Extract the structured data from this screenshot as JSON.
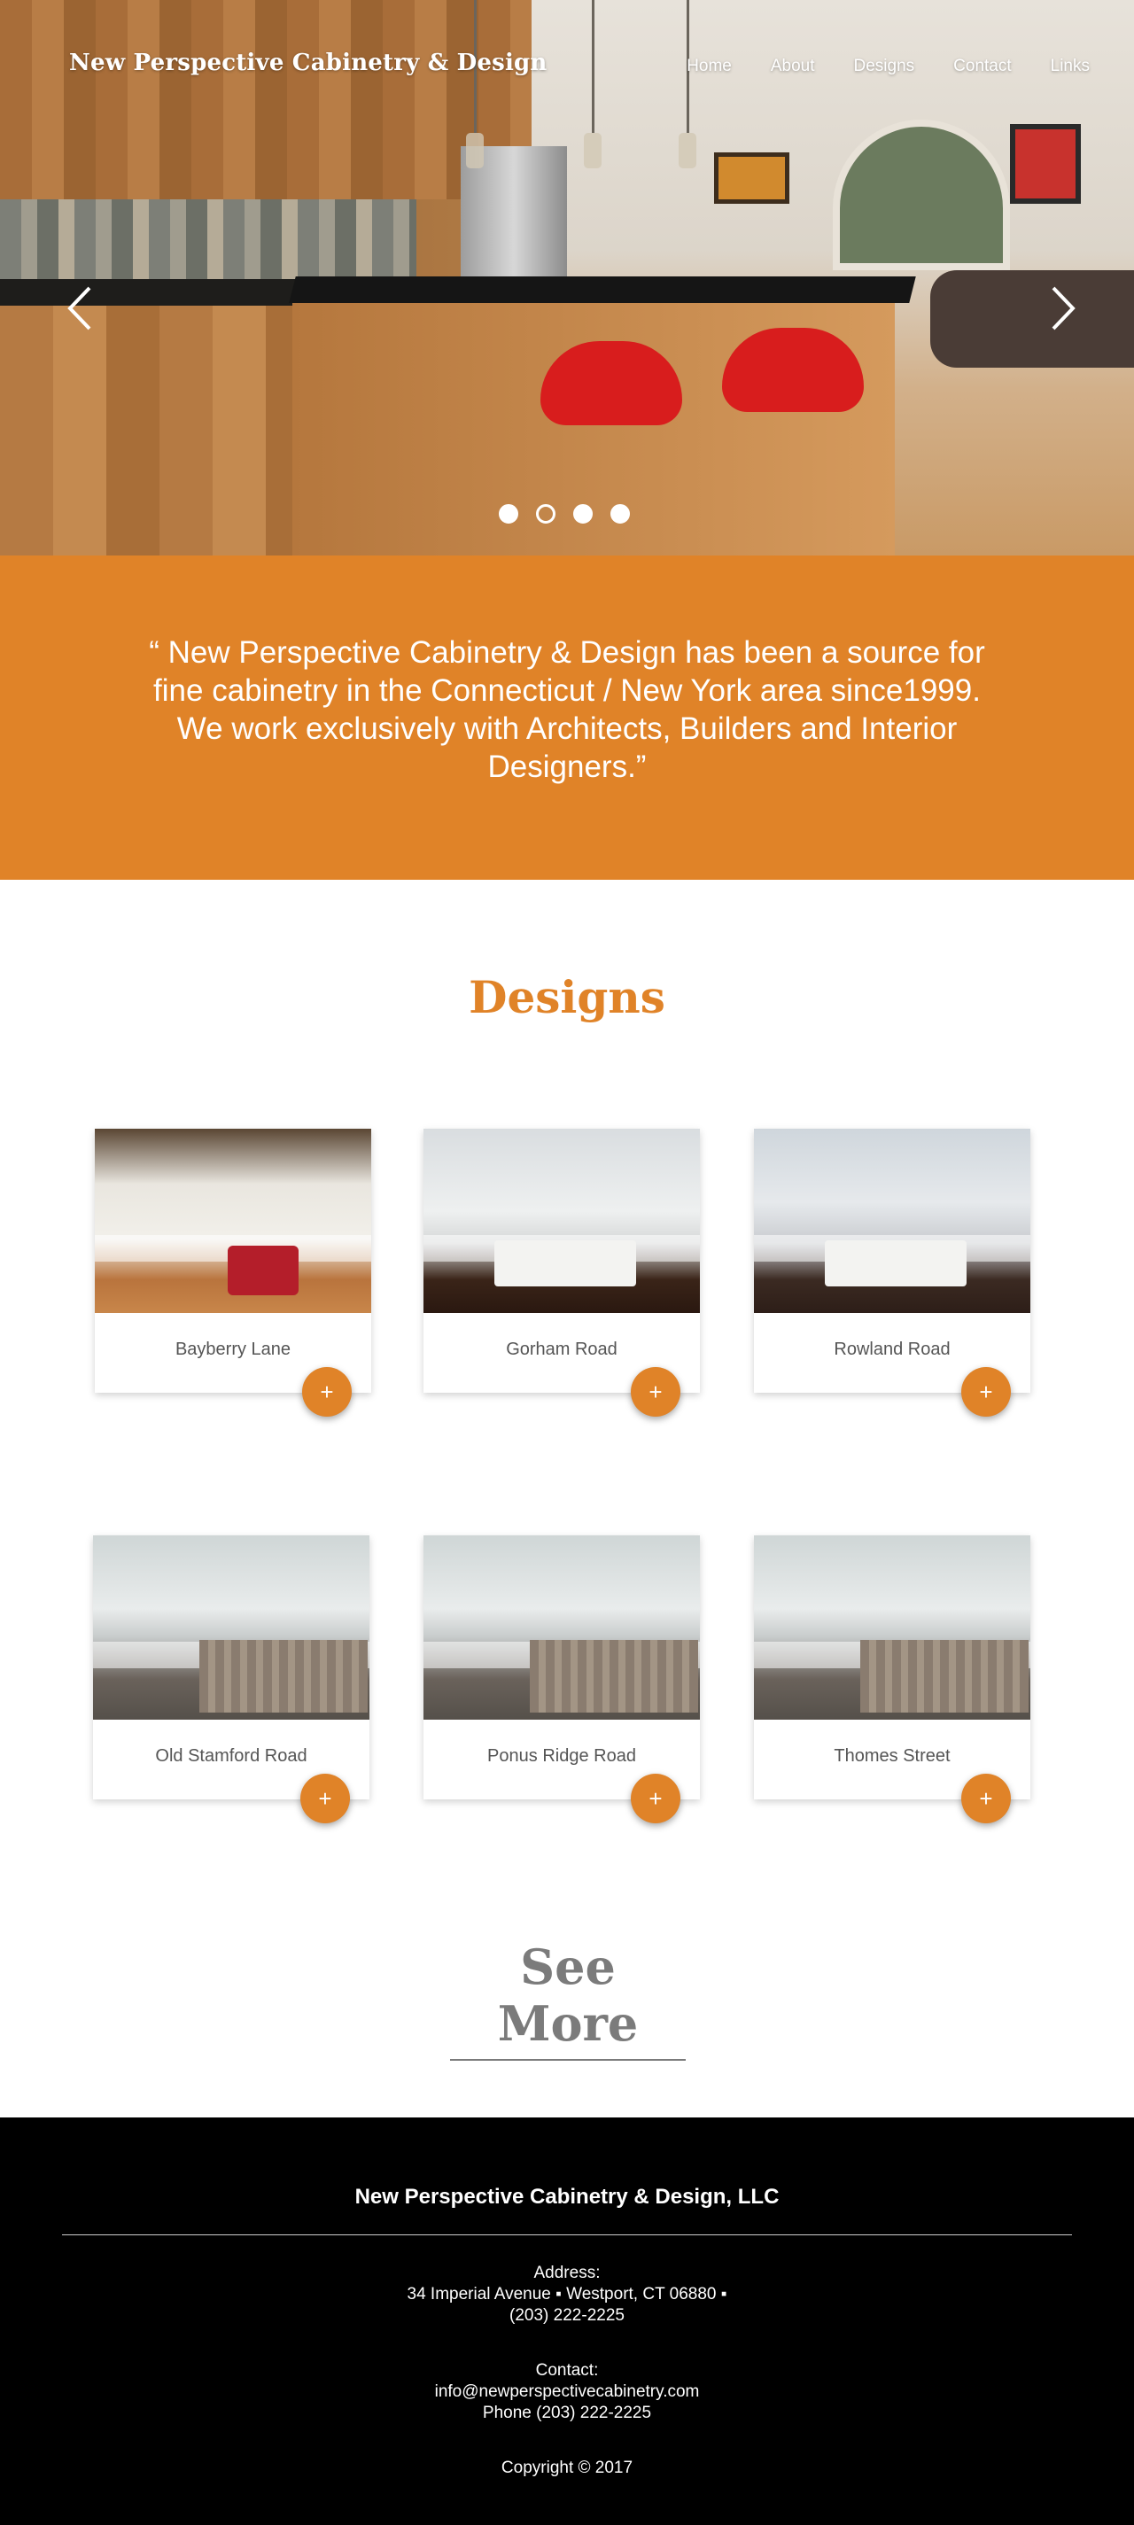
{
  "header": {
    "brand": "New Perspective Cabinetry & Design",
    "nav": [
      "Home",
      "About",
      "Designs",
      "Contact",
      "Links"
    ]
  },
  "hero": {
    "arrows": {
      "prev": "chevron-left-icon",
      "next": "chevron-right-icon"
    },
    "slide_count": 4,
    "active_slide": 2
  },
  "quote": "“ New Perspective Cabinetry & Design has been a source for fine cabinetry in the Connecticut / New York area since1999. We work exclusively with Architects, Builders and Interior Designers.”",
  "designs": {
    "heading": "Designs",
    "cards": [
      {
        "name": "Bayberry Lane",
        "action": "+"
      },
      {
        "name": "Gorham Road",
        "action": "+"
      },
      {
        "name": "Rowland Road",
        "action": "+"
      },
      {
        "name": "Old Stamford Road",
        "action": "+"
      },
      {
        "name": "Ponus Ridge Road",
        "action": "+"
      },
      {
        "name": "Thomes Street",
        "action": "+"
      }
    ],
    "see_more": "See More"
  },
  "footer": {
    "company": "New Perspective Cabinetry & Design, LLC",
    "address_label": "Address:",
    "address": "34 Imperial Avenue ▪ Westport, CT 06880 ▪",
    "address_phone": "(203) 222-2225",
    "contact_label": "Contact:",
    "email": "info@newperspectivecabinetry.com",
    "phone": "Phone (203) 222-2225",
    "copyright": "Copyright © 2017"
  },
  "colors": {
    "accent": "#e08328",
    "footer_bg": "#000000",
    "heading_gray": "#7b7b7b"
  }
}
